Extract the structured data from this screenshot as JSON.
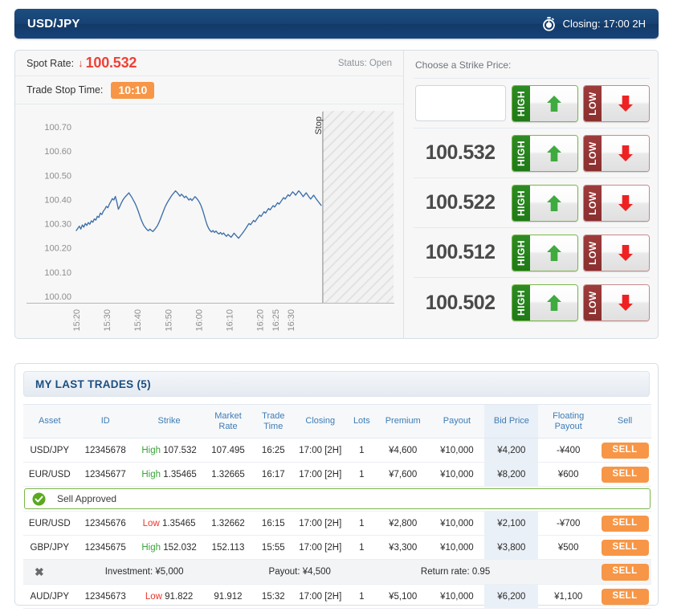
{
  "header": {
    "title": "USD/JPY",
    "clock_icon": "stopwatch-icon",
    "closing": "Closing: 17:00 2H"
  },
  "trade_panel": {
    "spot_label": "Spot Rate:",
    "spot_arrow": "↓",
    "spot_value": "100.532",
    "status": "Status: Open",
    "stop_time_label": "Trade Stop Time:",
    "stop_time_value": "10:10",
    "accent_orange": "#f79646",
    "spot_red": "#ef4036",
    "header_blue": "#1c4e80"
  },
  "chart_data": {
    "type": "line",
    "title": "",
    "xlabel": "",
    "ylabel": "",
    "ylim": [
      100.0,
      100.75
    ],
    "ytick_labels": [
      "100.70",
      "100.60",
      "100.50",
      "100.40",
      "100.30",
      "100.20",
      "100.10",
      "100.00"
    ],
    "ytick_values": [
      100.7,
      100.6,
      100.5,
      100.4,
      100.3,
      100.2,
      100.1,
      100.0
    ],
    "xtick_labels": [
      "15:20",
      "15:30",
      "15:40",
      "15:50",
      "16:00",
      "16:10",
      "16:20",
      "16:25",
      "16:30"
    ],
    "grid": false,
    "line_color": "#3d6fa8",
    "stop_marker_label": "Stop",
    "series": [
      {
        "name": "USD/JPY",
        "values": [
          100.272,
          100.281,
          100.29,
          100.278,
          100.295,
          100.286,
          100.301,
          100.293,
          100.305,
          100.298,
          100.312,
          100.306,
          100.32,
          100.315,
          100.331,
          100.326,
          100.344,
          100.338,
          100.352,
          100.36,
          100.372,
          100.366,
          100.381,
          100.392,
          100.404,
          100.398,
          100.413,
          100.389,
          100.36,
          100.372,
          100.386,
          100.398,
          100.407,
          100.414,
          100.421,
          100.428,
          100.418,
          100.409,
          100.397,
          100.386,
          100.372,
          100.356,
          100.338,
          100.32,
          100.305,
          100.292,
          100.284,
          100.276,
          100.271,
          100.278,
          100.272,
          100.268,
          100.275,
          100.283,
          100.292,
          100.305,
          100.32,
          100.336,
          100.352,
          100.368,
          100.381,
          100.392,
          100.402,
          100.412,
          100.421,
          100.428,
          100.436,
          100.43,
          100.422,
          100.414,
          100.422,
          100.416,
          100.408,
          100.414,
          100.406,
          100.398,
          100.404,
          100.396,
          100.404,
          100.412,
          100.406,
          100.398,
          100.388,
          100.375,
          100.358,
          100.338,
          100.316,
          100.296,
          100.282,
          100.272,
          100.266,
          100.272,
          100.264,
          100.27,
          100.262,
          100.258,
          100.264,
          100.256,
          100.262,
          100.254,
          100.248,
          100.256,
          100.25,
          100.244,
          100.252,
          100.261,
          100.254,
          100.247,
          100.24,
          100.248,
          100.256,
          100.264,
          100.273,
          100.282,
          100.292,
          100.301,
          100.296,
          100.305,
          100.314,
          100.308,
          100.318,
          100.327,
          100.336,
          100.33,
          100.34,
          100.35,
          100.344,
          100.354,
          100.363,
          100.357,
          100.366,
          100.375,
          100.369,
          100.378,
          100.387,
          100.381,
          100.39,
          100.399,
          100.408,
          100.402,
          100.411,
          100.42,
          100.414,
          100.423,
          100.432,
          100.426,
          100.418,
          100.427,
          100.436,
          100.43,
          100.421,
          100.412,
          100.42,
          100.428,
          100.419,
          100.41,
          100.402,
          100.41,
          100.418,
          100.409,
          100.4,
          100.392,
          100.384,
          100.376
        ]
      }
    ]
  },
  "strike": {
    "heading": "Choose a Strike Price:",
    "input_value": "",
    "input_placeholder": "",
    "high_label": "HIGH",
    "low_label": "LOW",
    "high_icon": "arrow-up-icon",
    "low_icon": "arrow-down-icon",
    "high_color": "#2e8b23",
    "low_color": "#9e3b3b",
    "rows": [
      {
        "price": "100.532"
      },
      {
        "price": "100.522"
      },
      {
        "price": "100.512"
      },
      {
        "price": "100.502"
      }
    ]
  },
  "trades": {
    "title": "MY LAST TRADES (5)",
    "columns": [
      "Asset",
      "ID",
      "Strike",
      "Market Rate",
      "Trade Time",
      "Closing",
      "Lots",
      "Premium",
      "Payout",
      "Bid Price",
      "Floating Payout",
      "Sell"
    ],
    "sell_label": "SELL",
    "rows": [
      {
        "asset": "USD/JPY",
        "id": "12345678",
        "direction": "High",
        "strike": "107.532",
        "market_rate": "107.495",
        "trade_time": "16:25",
        "closing": "17:00 [2H]",
        "lots": "1",
        "premium": "¥4,600",
        "payout": "¥10,000",
        "bid_price": "¥4,200",
        "floating_payout": "-¥400"
      },
      {
        "asset": "EUR/USD",
        "id": "12345677",
        "direction": "High",
        "strike": "1.35465",
        "market_rate": "1.32665",
        "trade_time": "16:17",
        "closing": "17:00 [2H]",
        "lots": "1",
        "premium": "¥7,600",
        "payout": "¥10,000",
        "bid_price": "¥8,200",
        "floating_payout": "¥600"
      },
      {
        "asset": "EUR/USD",
        "id": "12345676",
        "direction": "Low",
        "strike": "1.35465",
        "market_rate": "1.32662",
        "trade_time": "16:15",
        "closing": "17:00 [2H]",
        "lots": "1",
        "premium": "¥2,800",
        "payout": "¥10,000",
        "bid_price": "¥2,100",
        "floating_payout": "-¥700"
      },
      {
        "asset": "GBP/JPY",
        "id": "12345675",
        "direction": "High",
        "strike": "152.032",
        "market_rate": "152.113",
        "trade_time": "15:55",
        "closing": "17:00 [2H]",
        "lots": "1",
        "premium": "¥3,300",
        "payout": "¥10,000",
        "bid_price": "¥3,800",
        "floating_payout": "¥500"
      },
      {
        "asset": "AUD/JPY",
        "id": "12345673",
        "direction": "Low",
        "strike": "91.822",
        "market_rate": "91.912",
        "trade_time": "15:32",
        "closing": "17:00 [2H]",
        "lots": "1",
        "premium": "¥5,100",
        "payout": "¥10,000",
        "bid_price": "¥6,200",
        "floating_payout": "¥1,100"
      }
    ],
    "notification": {
      "icon": "check-circle-icon",
      "text": "Sell Approved",
      "border_color": "#7ab648"
    },
    "detail": {
      "close_icon": "close-icon",
      "investment": "Investment: ¥5,000",
      "payout": "Payout: ¥4,500",
      "return_rate": "Return rate: 0.95"
    }
  }
}
